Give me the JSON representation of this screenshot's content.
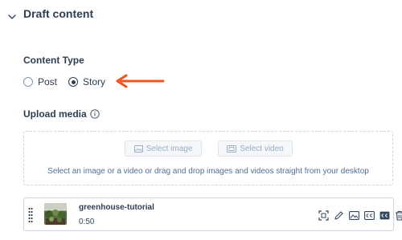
{
  "section": {
    "title": "Draft content"
  },
  "content_type": {
    "label": "Content Type",
    "options": [
      {
        "label": "Post",
        "selected": false
      },
      {
        "label": "Story",
        "selected": true
      }
    ]
  },
  "annotation": {
    "arrow_color": "#f0541e"
  },
  "upload_media": {
    "label": "Upload media",
    "select_image_label": "Select image",
    "select_video_label": "Select video",
    "hint": "Select an image or a video or drag and drop images and videos straight from your desktop"
  },
  "media_item": {
    "name": "greenhouse-tutorial",
    "duration": "0:50",
    "actions": [
      "crop-icon",
      "edit-icon",
      "image-icon",
      "captions-icon",
      "closed-captions-icon",
      "trash-icon"
    ]
  },
  "colors": {
    "text": "#2d3e50",
    "border": "#cbd6e2",
    "accent": "#f0541e"
  }
}
